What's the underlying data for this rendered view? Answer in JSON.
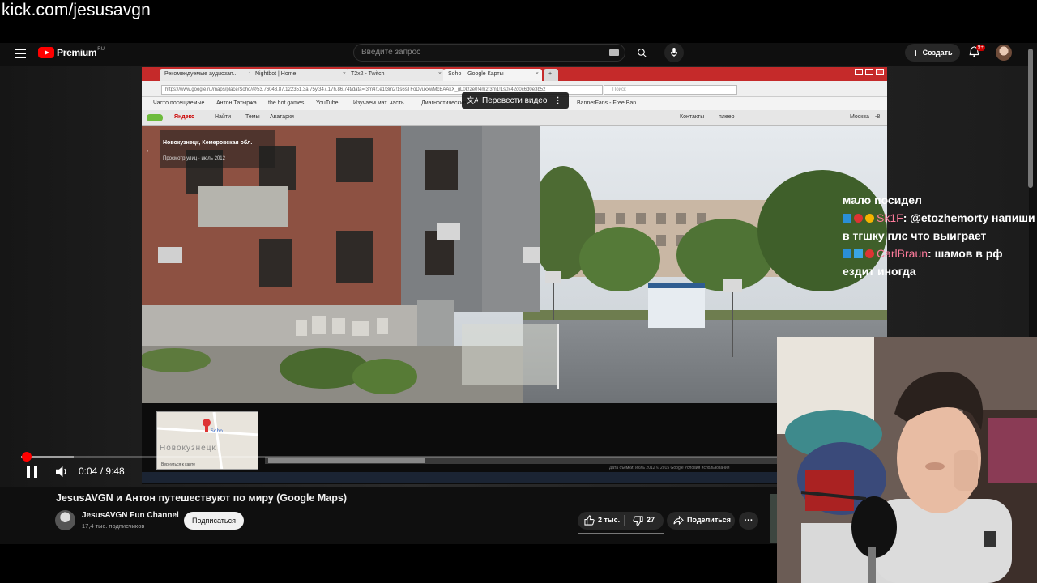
{
  "overlay": {
    "stream_url": "kick.com/jesusavgn"
  },
  "masthead": {
    "logo_text": "Premium",
    "logo_region": "RU",
    "search_placeholder": "Введите запрос",
    "create_label": "Создать",
    "notifications_badge": "9+"
  },
  "browser": {
    "tabs": [
      {
        "label": "Рекомендуемые аудиозап..."
      },
      {
        "label": "Nightbot | Home"
      },
      {
        "label": "T2x2 - Twitch"
      },
      {
        "label": "Soho – Google Карты"
      }
    ],
    "address": "https://www.google.ru/maps/place/Soho/@53.76043,87.122351,3a,75y,347.17h,86.74t/data=!3m4!1e1!3m2!1s6sTFoDvuxxwMcBAAkX_gL0k!2e0!4m2!3m1!1s0x42d0c6d0e3b52",
    "search_placeholder": "Поиск",
    "bookmarks": [
      {
        "label": "Часто посещаемые"
      },
      {
        "label": "Антон Татыржа"
      },
      {
        "label": "the hot games"
      },
      {
        "label": "YouTube"
      },
      {
        "label": "Изучаем мат. часть ..."
      },
      {
        "label": "Диагностические ..."
      },
      {
        "label": "BannerFans - Free Ban..."
      }
    ],
    "yandex_bar": {
      "brand": "Яндекс",
      "find": "Найти",
      "themes": "Темы",
      "avatars": "Аватарки",
      "contacts": "Контакты",
      "player": "плеер",
      "city": "Москва",
      "temp": "-8"
    },
    "translate_button": "Перевести видео",
    "streetview": {
      "location": "Новокузнецк, Кемеровская обл.",
      "date": "Просмотр улиц · июль 2012"
    },
    "minimap": {
      "label": "Новокузнецк",
      "pin_label": "Soho",
      "back": "Вернуться к карте"
    },
    "copyright": "Дата съемки: июль 2012    © 2015 Google    Условия использования"
  },
  "player": {
    "time": "0:04 / 9:48",
    "progress": 0.007,
    "buffered": 0.07
  },
  "chat": {
    "lines": [
      {
        "text": "мало посидел"
      },
      {
        "name": "Sk1F",
        "message": ": @etozhemorty напиши в тгшку плс что выиграет"
      },
      {
        "name": "CarlBraun",
        "message": ": шамов в рф ездит иногда"
      }
    ]
  },
  "video": {
    "title": "JesusAVGN и Антон путешествуют по миру (Google Maps)",
    "channel_name": "JesusAVGN Fun Channel",
    "subscribers": "17,4 тыс. подписчиков",
    "subscribe_label": "Подписаться",
    "likes": "2 тыс.",
    "dislikes": "27",
    "share_label": "Поделиться",
    "more_label": "···"
  },
  "colors": {
    "youtube_red": "#ff0000",
    "chat_name": "#ff7b9c",
    "browser_tabbar": "#c52a2a"
  }
}
